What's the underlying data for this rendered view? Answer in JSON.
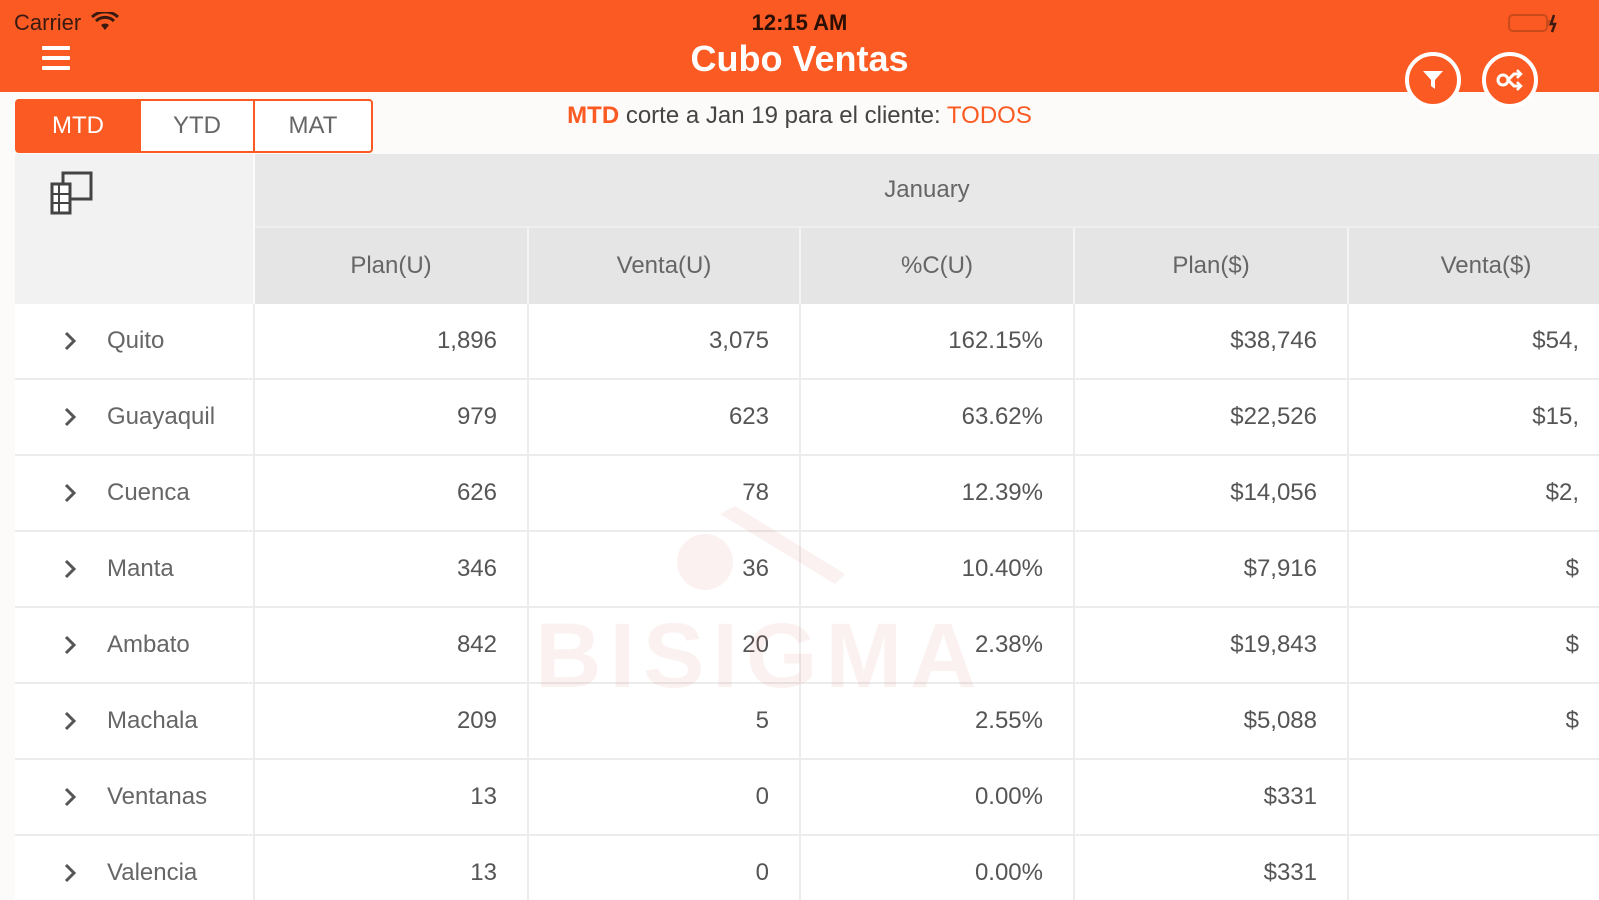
{
  "status_bar": {
    "carrier": "Carrier",
    "time": "12:15 AM"
  },
  "header": {
    "title": "Cubo Ventas",
    "menu_icon": "hamburger-icon",
    "filter_icon": "filter-icon",
    "settings_icon": "swap-settings-icon"
  },
  "segments": [
    {
      "label": "MTD",
      "active": true
    },
    {
      "label": "YTD",
      "active": false
    },
    {
      "label": "MAT",
      "active": false
    }
  ],
  "info": {
    "period": "MTD",
    "text": " corte a Jan 19 para el cliente: ",
    "client": "TODOS"
  },
  "table": {
    "month": "January",
    "columns": [
      "Plan(U)",
      "Venta(U)",
      "%C(U)",
      "Plan($)",
      "Venta($)"
    ],
    "rows": [
      {
        "label": "Quito",
        "values": [
          "1,896",
          "3,075",
          "162.15%",
          "$38,746",
          "$54,"
        ]
      },
      {
        "label": "Guayaquil",
        "values": [
          "979",
          "623",
          "63.62%",
          "$22,526",
          "$15,"
        ]
      },
      {
        "label": "Cuenca",
        "values": [
          "626",
          "78",
          "12.39%",
          "$14,056",
          "$2,"
        ]
      },
      {
        "label": "Manta",
        "values": [
          "346",
          "36",
          "10.40%",
          "$7,916",
          "$"
        ]
      },
      {
        "label": "Ambato",
        "values": [
          "842",
          "20",
          "2.38%",
          "$19,843",
          "$"
        ]
      },
      {
        "label": "Machala",
        "values": [
          "209",
          "5",
          "2.55%",
          "$5,088",
          "$"
        ]
      },
      {
        "label": "Ventanas",
        "values": [
          "13",
          "0",
          "0.00%",
          "$331",
          ""
        ]
      },
      {
        "label": "Valencia",
        "values": [
          "13",
          "0",
          "0.00%",
          "$331",
          ""
        ]
      }
    ]
  },
  "watermark": "BISIGMA",
  "colors": {
    "accent": "#fb5a22",
    "header_bg": "#fb5a22",
    "table_header_bg": "#e5e5e5"
  }
}
